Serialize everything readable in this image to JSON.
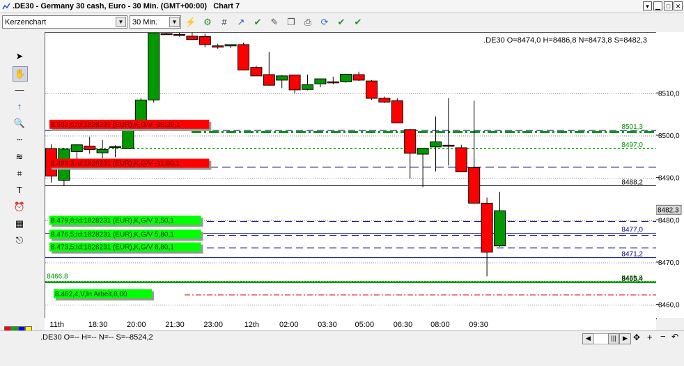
{
  "window": {
    "title": ".DE30 - Germany 30 cash, Euro - 30 Min. (GMT+00:00)   Chart 7",
    "buttons": [
      "minimize",
      "maximize-restore",
      "maximize",
      "close"
    ]
  },
  "toolbar": {
    "chart_type": "Kerzenchart",
    "timeframe": "30 Min.",
    "icons": [
      "indicator-add-icon",
      "indicator-settings-icon",
      "grid-icon",
      "trendline-icon",
      "edit-check-icon",
      "edit-icon",
      "copy-icon",
      "print-icon",
      "refresh-icon",
      "settings-check-icon",
      "verify-icon"
    ]
  },
  "left_tools": [
    "cursor-arrow-icon",
    "hand-pan-icon",
    "horizontal-line-icon",
    "arrow-up-icon",
    "zoom-icon",
    "dotted-lines-icon",
    "fibonacci-icon",
    "shapes-icon",
    "text-tool-icon",
    "alarm-clock-icon",
    "calculator-icon",
    "export-icon"
  ],
  "colors": {
    "bull": "#009900",
    "bear": "#ff0000",
    "palette": [
      "#ff0000",
      "#00aa00",
      "#0000ff",
      "#ffff00",
      "#ffffff",
      "#000000",
      "#990000",
      "#006600"
    ]
  },
  "ohlc_header": ".DE30 O=8474,0 H=8486,8 N=8473,8 S=8482,3",
  "status": {
    "ohlc": ".DE30 O=-- H=-- N=-- S=--",
    "value": "8524,2"
  },
  "chart_data": {
    "type": "candlestick",
    "y_ticks": [
      "8510,0",
      "8500,0",
      "8490,0",
      "8480,0",
      "8470,0",
      "8460,0"
    ],
    "y_tick_values": [
      8510,
      8500,
      8490,
      8480,
      8470,
      8460
    ],
    "ylim": [
      8456.8,
      8524.4
    ],
    "x_labels": [
      "11th",
      "18:30",
      "20:00",
      "21:30",
      "23:00",
      "12th",
      "02:00",
      "03:30",
      "05:00",
      "06:30",
      "08:00",
      "09:30"
    ],
    "x_label_index": [
      0.5,
      3.7,
      6.7,
      9.7,
      12.7,
      15.7,
      18.6,
      21.6,
      24.5,
      27.5,
      30.4,
      33.4
    ],
    "candles": [
      {
        "o": 8497.0,
        "h": 8498.0,
        "l": 8489.0,
        "c": 8490.5
      },
      {
        "o": 8489.5,
        "h": 8497.2,
        "l": 8488.2,
        "c": 8496.9
      },
      {
        "o": 8496.3,
        "h": 8498.0,
        "l": 8494.0,
        "c": 8497.9
      },
      {
        "o": 8497.6,
        "h": 8499.8,
        "l": 8495.8,
        "c": 8496.8
      },
      {
        "o": 8496.0,
        "h": 8499.0,
        "l": 8494.7,
        "c": 8496.8
      },
      {
        "o": 8497.3,
        "h": 8497.8,
        "l": 8495.0,
        "c": 8497.5
      },
      {
        "o": 8497.0,
        "h": 8503.2,
        "l": 8497.0,
        "c": 8502.5
      },
      {
        "o": 8502.5,
        "h": 8509.0,
        "l": 8502.0,
        "c": 8508.5
      },
      {
        "o": 8508.5,
        "h": 8524.4,
        "l": 8507.9,
        "c": 8524.4
      },
      {
        "o": 8524.2,
        "h": 8524.4,
        "l": 8523.9,
        "c": 8524.1
      },
      {
        "o": 8524.0,
        "h": 8524.4,
        "l": 8523.5,
        "c": 8523.8
      },
      {
        "o": 8523.6,
        "h": 8524.4,
        "l": 8522.8,
        "c": 8522.8
      },
      {
        "o": 8523.5,
        "h": 8524.2,
        "l": 8521.0,
        "c": 8521.6
      },
      {
        "o": 8521.3,
        "h": 8521.8,
        "l": 8520.6,
        "c": 8521.0
      },
      {
        "o": 8521.3,
        "h": 8521.6,
        "l": 8520.8,
        "c": 8521.6
      },
      {
        "o": 8521.6,
        "h": 8522.0,
        "l": 8515.5,
        "c": 8515.6
      },
      {
        "o": 8516.2,
        "h": 8516.6,
        "l": 8514.2,
        "c": 8514.2
      },
      {
        "o": 8514.5,
        "h": 8519.8,
        "l": 8511.9,
        "c": 8512.0
      },
      {
        "o": 8513.2,
        "h": 8514.4,
        "l": 8511.3,
        "c": 8514.2
      },
      {
        "o": 8514.4,
        "h": 8514.4,
        "l": 8510.1,
        "c": 8510.9
      },
      {
        "o": 8511.0,
        "h": 8514.5,
        "l": 8510.8,
        "c": 8512.1
      },
      {
        "o": 8512.3,
        "h": 8513.5,
        "l": 8511.5,
        "c": 8513.5
      },
      {
        "o": 8512.8,
        "h": 8514.0,
        "l": 8512.2,
        "c": 8512.7
      },
      {
        "o": 8512.8,
        "h": 8514.7,
        "l": 8512.6,
        "c": 8514.6
      },
      {
        "o": 8514.5,
        "h": 8515.2,
        "l": 8513.0,
        "c": 8513.2
      },
      {
        "o": 8513.0,
        "h": 8513.2,
        "l": 8508.5,
        "c": 8508.9
      },
      {
        "o": 8508.9,
        "h": 8509.3,
        "l": 8507.8,
        "c": 8508.0
      },
      {
        "o": 8508.3,
        "h": 8508.9,
        "l": 8503.0,
        "c": 8503.1
      },
      {
        "o": 8501.5,
        "h": 8501.7,
        "l": 8489.9,
        "c": 8495.9
      },
      {
        "o": 8495.7,
        "h": 8496.6,
        "l": 8487.9,
        "c": 8497.1
      },
      {
        "o": 8497.4,
        "h": 8504.6,
        "l": 8491.6,
        "c": 8498.6
      },
      {
        "o": 8497.8,
        "h": 8508.9,
        "l": 8493.0,
        "c": 8497.6
      },
      {
        "o": 8497.2,
        "h": 8497.9,
        "l": 8491.5,
        "c": 8491.5
      },
      {
        "o": 8492.5,
        "h": 8508.3,
        "l": 8487.2,
        "c": 8484.1
      },
      {
        "o": 8484.1,
        "h": 8485.4,
        "l": 8466.8,
        "c": 8472.5
      },
      {
        "o": 8474.0,
        "h": 8486.8,
        "l": 8473.8,
        "c": 8482.3
      }
    ],
    "current_price": "8482,3",
    "levels": [
      {
        "value": 8501.3,
        "label": "8501,3",
        "color": "#009900"
      },
      {
        "value": 8497.0,
        "label": "8497,0",
        "color": "#009900"
      },
      {
        "value": 8488.2,
        "label": "8488,2",
        "color": "#000000"
      },
      {
        "value": 8477.0,
        "label": "8477,0",
        "color": "#000080"
      },
      {
        "value": 8471.2,
        "label": "8471,2",
        "color": "#000080"
      },
      {
        "value": 8465.6,
        "label": "8465,6",
        "color": "#009900"
      },
      {
        "value": 8465.4,
        "label": "8465,4",
        "color": "#000000"
      }
    ],
    "orders": [
      {
        "text": "8.502,5;Id:1828231 (EUR),K,G/V -28,20,1",
        "color": "#ff0000"
      },
      {
        "text": "8.493,3;Id:1828231 (EUR),K,G/V -11,00,1",
        "color": "#ff0000"
      },
      {
        "text": "8.479,8;Id:1828231 (EUR),K,G/V 2,50,1",
        "color": "#00ff00"
      },
      {
        "text": "8.476,5;Id:1828231 (EUR),K,G/V 5,80,1",
        "color": "#00ff00"
      },
      {
        "text": "8.473,5;Id:1828231 (EUR),K,G/V 8,80,1",
        "color": "#00ff00"
      },
      {
        "text": "8.462,4,V,In Arbeit,8,00",
        "color": "#00ff00"
      }
    ],
    "low_label": "8466,8"
  }
}
